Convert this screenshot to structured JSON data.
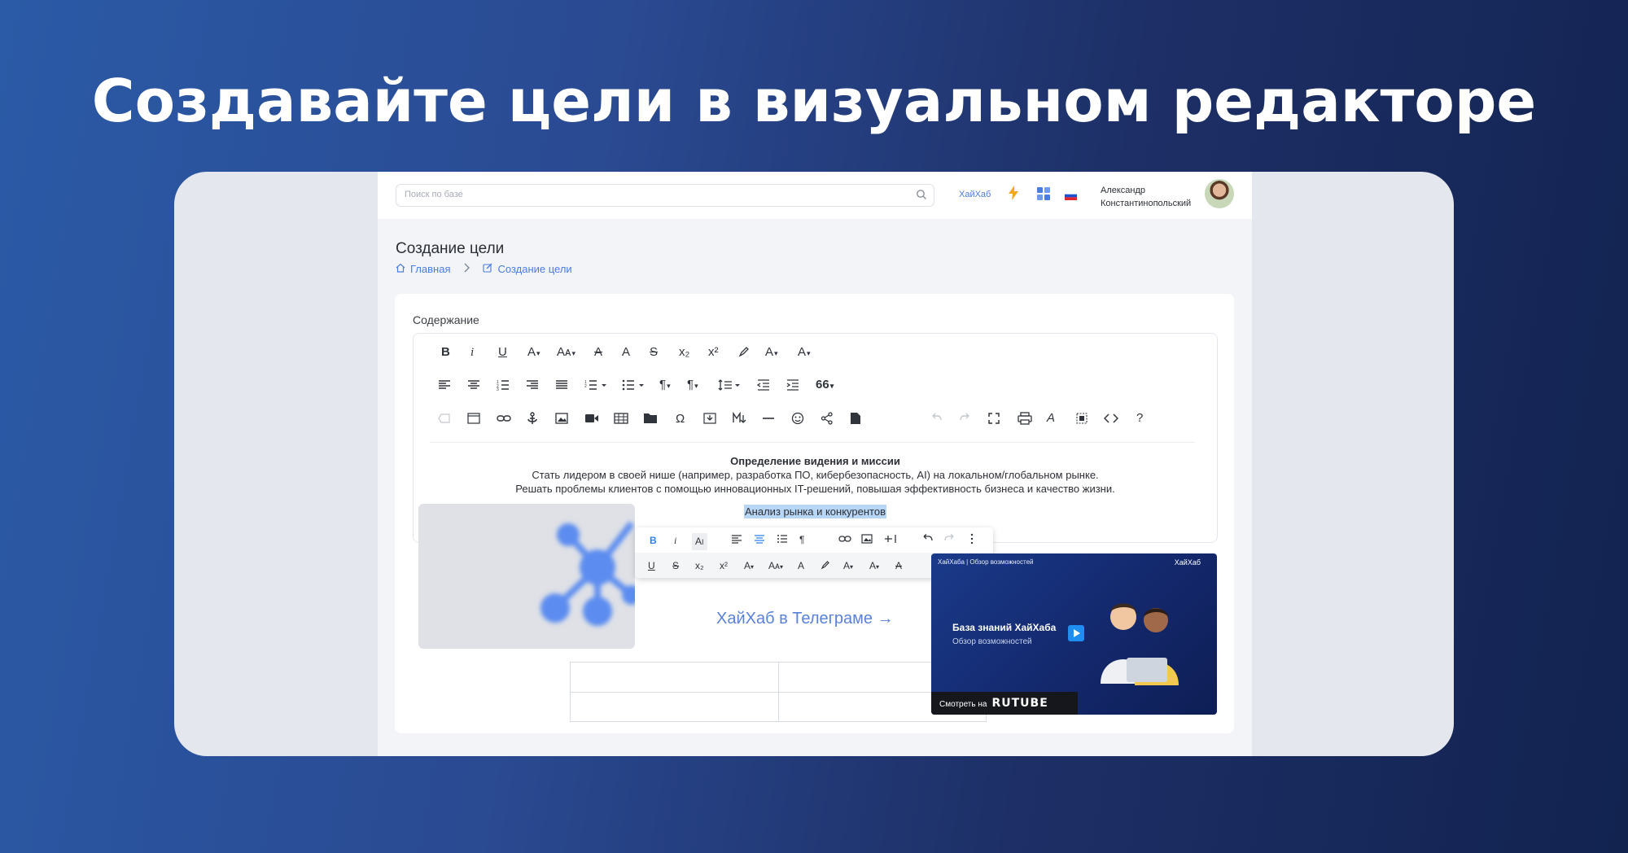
{
  "headline": "Создавайте цели в визуальном редакторе",
  "topbar": {
    "search_placeholder": "Поиск по базе",
    "brand_link": "ХайХаб",
    "user_first": "Александр",
    "user_last": "Константинопольский"
  },
  "page": {
    "title": "Создание цели",
    "breadcrumb": [
      "Главная",
      "Создание цели"
    ]
  },
  "editor": {
    "label": "Содержание",
    "heading": "Определение видения и миссии",
    "line1": "Стать лидером в своей нише (например, разработка ПО, кибербезопасность, AI) на локальном/глобальном рынке.",
    "line2": "Решать проблемы клиентов с помощью инновационных IT-решений, повышая эффективность бизнеса и качество жизни.",
    "selected": "Анализ рынка и конкурентов",
    "telegram_link": "ХайХаб в Телеграме →",
    "toolbar_glyphs": {
      "subscript": "x₂",
      "superscript": "x²",
      "omega": "Ω",
      "help": "?",
      "quote": "66"
    }
  },
  "video": {
    "top_title": "ХайХаба | Обзор возможностей",
    "brand": "ХайХаб",
    "title": "База знаний ХайХаба",
    "subtitle": "Обзор возможностей",
    "watch": "Смотреть на",
    "platform": "RUTUBE"
  },
  "colors": {
    "accent": "#4a7de0",
    "selection": "#b7d6f5",
    "active": "#2f80ed"
  }
}
